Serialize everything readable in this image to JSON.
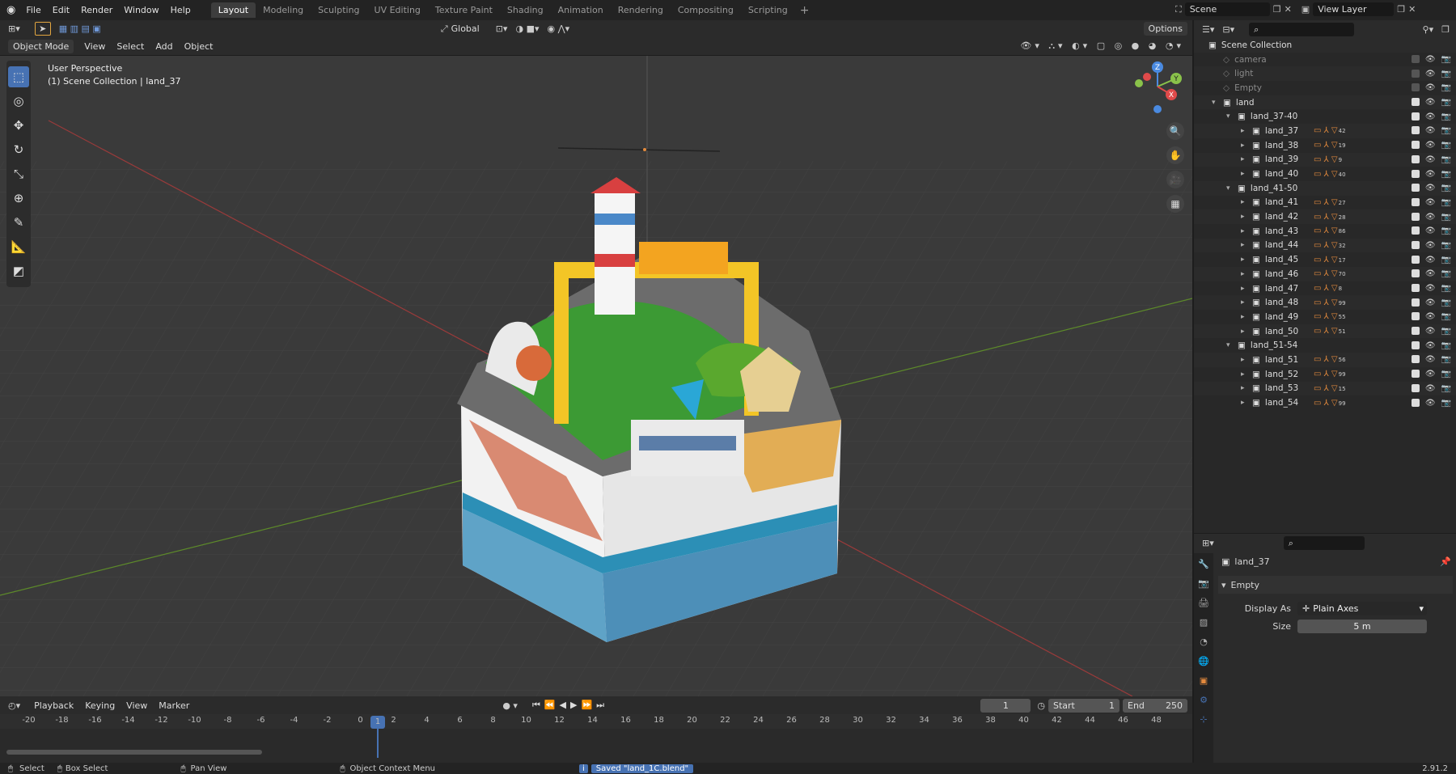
{
  "topbar": {
    "menus": [
      "File",
      "Edit",
      "Render",
      "Window",
      "Help"
    ],
    "tabs": [
      "Layout",
      "Modeling",
      "Sculpting",
      "UV Editing",
      "Texture Paint",
      "Shading",
      "Animation",
      "Rendering",
      "Compositing",
      "Scripting"
    ],
    "active_tab": "Layout",
    "scene": "Scene",
    "view_layer": "View Layer"
  },
  "viewport_header": {
    "mode": "Object Mode",
    "menus": [
      "View",
      "Select",
      "Add",
      "Object"
    ],
    "orientation": "Global",
    "options": "Options"
  },
  "viewport": {
    "perspective": "User Perspective",
    "collection": "(1) Scene Collection | land_37",
    "axes": {
      "x": "X",
      "y": "Y",
      "z": "Z"
    }
  },
  "timeline": {
    "menus": [
      "Playback",
      "Keying",
      "View",
      "Marker"
    ],
    "current_frame": "1",
    "start_label": "Start",
    "start": "1",
    "end_label": "End",
    "end": "250",
    "ticks": [
      "-20",
      "-18",
      "-16",
      "-14",
      "-12",
      "-10",
      "-8",
      "-6",
      "-4",
      "-2",
      "0",
      "1",
      "2",
      "4",
      "6",
      "8",
      "10",
      "12",
      "14",
      "16",
      "18",
      "20",
      "22",
      "24",
      "26",
      "28",
      "30",
      "32",
      "34",
      "36",
      "38",
      "40",
      "42",
      "44",
      "46",
      "48"
    ]
  },
  "statusbar": {
    "select": "Select",
    "box_select": "Box Select",
    "pan_view": "Pan View",
    "context_menu": "Object Context Menu",
    "message": "Saved \"land_1C.blend\"",
    "version": "2.91.2"
  },
  "outliner": {
    "root": "Scene Collection",
    "rows": [
      {
        "name": "camera",
        "depth": 1,
        "dim": true
      },
      {
        "name": "light",
        "depth": 1,
        "dim": true
      },
      {
        "name": "Empty",
        "depth": 1,
        "dim": true
      },
      {
        "name": "land",
        "depth": 1,
        "dim": false
      },
      {
        "name": "land_37-40",
        "depth": 2,
        "dim": false
      },
      {
        "name": "land_37",
        "depth": 3,
        "dim": false,
        "badge": "42"
      },
      {
        "name": "land_38",
        "depth": 3,
        "dim": false,
        "badge": "19"
      },
      {
        "name": "land_39",
        "depth": 3,
        "dim": false,
        "badge": "9"
      },
      {
        "name": "land_40",
        "depth": 3,
        "dim": false,
        "badge": "40"
      },
      {
        "name": "land_41-50",
        "depth": 2,
        "dim": false
      },
      {
        "name": "land_41",
        "depth": 3,
        "dim": false,
        "badge": "27"
      },
      {
        "name": "land_42",
        "depth": 3,
        "dim": false,
        "badge": "28"
      },
      {
        "name": "land_43",
        "depth": 3,
        "dim": false,
        "badge": "86"
      },
      {
        "name": "land_44",
        "depth": 3,
        "dim": false,
        "badge": "32"
      },
      {
        "name": "land_45",
        "depth": 3,
        "dim": false,
        "badge": "17"
      },
      {
        "name": "land_46",
        "depth": 3,
        "dim": false,
        "badge": "70"
      },
      {
        "name": "land_47",
        "depth": 3,
        "dim": false,
        "badge": "8"
      },
      {
        "name": "land_48",
        "depth": 3,
        "dim": false,
        "badge": "99"
      },
      {
        "name": "land_49",
        "depth": 3,
        "dim": false,
        "badge": "55"
      },
      {
        "name": "land_50",
        "depth": 3,
        "dim": false,
        "badge": "51"
      },
      {
        "name": "land_51-54",
        "depth": 2,
        "dim": false
      },
      {
        "name": "land_51",
        "depth": 3,
        "dim": false,
        "badge": "56"
      },
      {
        "name": "land_52",
        "depth": 3,
        "dim": false,
        "badge": "99"
      },
      {
        "name": "land_53",
        "depth": 3,
        "dim": false,
        "badge": "15"
      },
      {
        "name": "land_54",
        "depth": 3,
        "dim": false,
        "badge": "99"
      }
    ]
  },
  "properties": {
    "object": "land_37",
    "panel": "Empty",
    "display_as_label": "Display As",
    "display_as": "Plain Axes",
    "size_label": "Size",
    "size": "5 m"
  },
  "colors": {
    "accent": "#4772b3",
    "background": "#3a3a3a",
    "orange": "#e38a3d"
  }
}
